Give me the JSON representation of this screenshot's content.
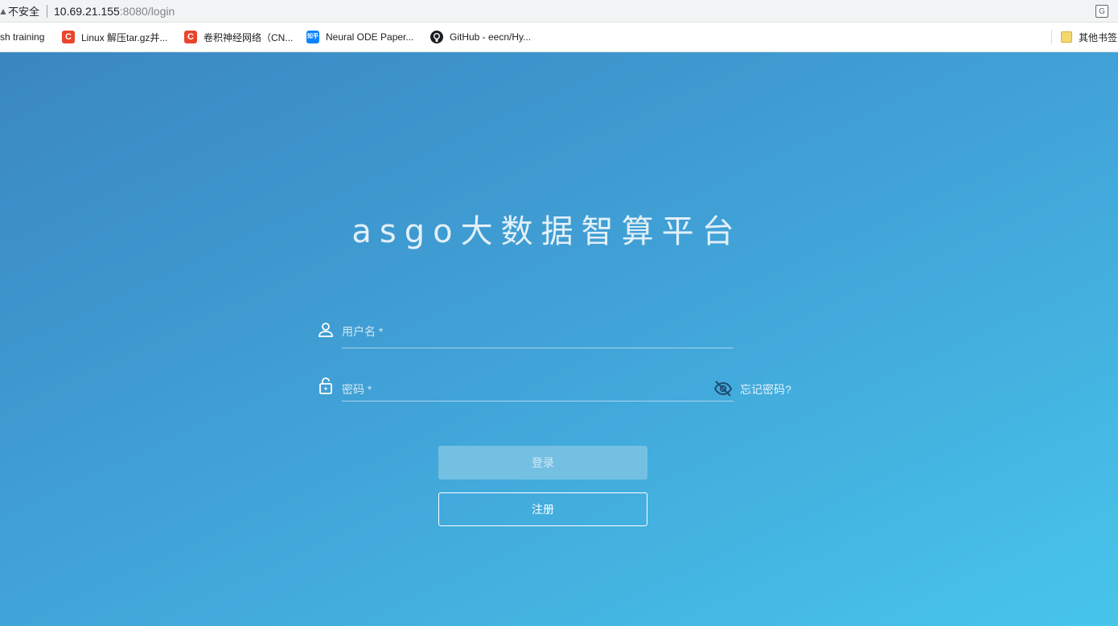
{
  "browser": {
    "security_label": "不安全",
    "url_host": "10.69.21.155",
    "url_path": ":8080/login",
    "translate_icon": "translate-icon"
  },
  "bookmarks": [
    {
      "label": "sh training",
      "icon": "none"
    },
    {
      "label": "Linux 解压tar.gz并...",
      "icon": "c-logo-icon"
    },
    {
      "label": "卷积神经网络（CN...",
      "icon": "c-logo-icon"
    },
    {
      "label": "Neural ODE Paper...",
      "icon": "zhihu-icon"
    },
    {
      "label": "GitHub - eecn/Hy...",
      "icon": "github-icon"
    },
    {
      "label": "其他书签",
      "icon": "folder-icon"
    }
  ],
  "login": {
    "title": "asgo大数据智算平台",
    "username_label": "用户名 *",
    "password_label": "密码 *",
    "forgot_password": "忘记密码?",
    "login_button": "登录",
    "register_button": "注册"
  },
  "colors": {
    "gradient_start": "#3a87c1",
    "gradient_end": "#47c5ea",
    "login_button_bg": "#74c0e3"
  }
}
